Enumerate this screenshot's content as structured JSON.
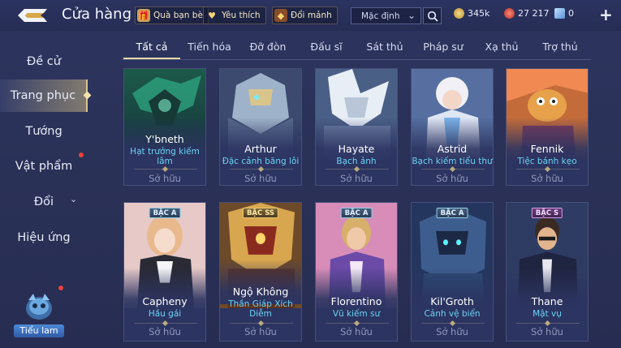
{
  "header": {
    "title": "Cửa hàng",
    "gift_label": "Quà bạn bè",
    "favorite_label": "Yêu thích",
    "exchange_label": "Đổi mảnh",
    "sort_value": "Mặc định",
    "gold": "345k",
    "coupons": "27 217",
    "vouchers": "0"
  },
  "sidebar": {
    "items": [
      {
        "label": "Đề cử"
      },
      {
        "label": "Trang phục"
      },
      {
        "label": "Tướng"
      },
      {
        "label": "Vật phẩm"
      },
      {
        "label": "Đổi"
      },
      {
        "label": "Hiệu ứng"
      }
    ],
    "mascot_label": "Tiểu lam"
  },
  "tabs": [
    "Tất cả",
    "Tiến hóa",
    "Đỡ đòn",
    "Đấu sĩ",
    "Sát thủ",
    "Pháp sư",
    "Xạ thủ",
    "Trợ thủ"
  ],
  "cards": [
    {
      "hero": "Y'bneth",
      "skin": "Hạt trưởng kiếm lâm",
      "status": "Sở hữu",
      "tier": ""
    },
    {
      "hero": "Arthur",
      "skin": "Đặc cảnh băng lôi",
      "status": "Sở hữu",
      "tier": ""
    },
    {
      "hero": "Hayate",
      "skin": "Bạch ảnh",
      "status": "Sở hữu",
      "tier": ""
    },
    {
      "hero": "Astrid",
      "skin": "Bạch kiếm tiểu thư",
      "status": "Sở hữu",
      "tier": ""
    },
    {
      "hero": "Fennik",
      "skin": "Tiệc bánh kẹo",
      "status": "Sở hữu",
      "tier": ""
    },
    {
      "hero": "Capheny",
      "skin": "Hầu gái",
      "status": "Sở hữu",
      "tier": "BẬC A"
    },
    {
      "hero": "Ngộ Không",
      "skin": "Thần Giáp Xích Diễm",
      "status": "Sở hữu",
      "tier": "BẬC SS"
    },
    {
      "hero": "Florentino",
      "skin": "Vũ kiếm sư",
      "status": "Sở hữu",
      "tier": "BẬC A"
    },
    {
      "hero": "Kil'Groth",
      "skin": "Cảnh vệ biển",
      "status": "Sở hữu",
      "tier": "BẬC A"
    },
    {
      "hero": "Thane",
      "skin": "Mật vụ",
      "status": "Sở hữu",
      "tier": "BẬC S"
    }
  ],
  "colors": {
    "background": "#2a3157",
    "skin_name": "#6bd3f5",
    "owned_text": "#8f98bb",
    "accent_gold": "#e8d9a8",
    "notification": "#e8433a"
  }
}
